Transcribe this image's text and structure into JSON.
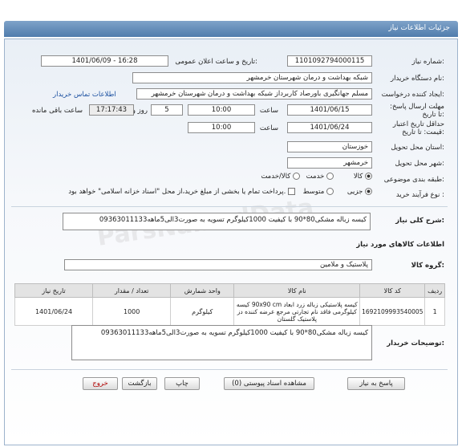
{
  "header": {
    "title": "جزئیات اطلاعات نیاز"
  },
  "fields": {
    "need_number_label": "شماره نیاز:",
    "need_number": "1101092794000115",
    "announce_label": "تاریخ و ساعت اعلان عمومی:",
    "announce_value": "1401/06/09 - 16:28",
    "buyer_label": "نام دستگاه خریدار:",
    "buyer_value": "شبکه بهداشت و درمان شهرستان خرمشهر",
    "creator_label": "ایجاد کننده درخواست:",
    "creator_value": "مسلم جهانگیری باورصاد کاربرداز شبکه بهداشت و درمان شهرستان خرمشهر",
    "contact_link": "اطلاعات تماس خریدار",
    "deadline_label": "مهلت ارسال پاسخ: تا تاریخ:",
    "deadline_date": "1401/06/15",
    "time_label": "ساعت",
    "deadline_time": "10:00",
    "days_value": "5",
    "days_label": "روز و",
    "remaining_time": "17:17:43",
    "remaining_label": "ساعت باقی مانده",
    "validity_label": "حداقل تاریخ اعتبار قیمت: تا تاریخ:",
    "validity_date": "1401/06/24",
    "validity_time_label": "ساعت",
    "validity_time": "10:00",
    "province_label": "استان محل تحویل:",
    "province_value": "خوزستان",
    "city_label": "شهر محل تحویل:",
    "city_value": "خرمشهر",
    "category_label": "طبقه بندی موضوعی:",
    "category_options": [
      "کالا",
      "خدمت",
      "کالا/خدمت"
    ],
    "process_label": "نوع فرآیند خرید :",
    "process_options": [
      "جزیی",
      "متوسط"
    ],
    "payment_text": "پرداخت تمام یا بخشی از مبلغ خرید،از محل \"اسناد خزانه اسلامی\" خواهد بود."
  },
  "summary": {
    "label": "شرح کلی نیاز:",
    "value": "کیسه زباله مشکی80*90 با کیفیت 1000کیلوگرم تسویه به صورت3الی5ماهه09363011133"
  },
  "goods_section": {
    "title": "اطلاعات کالاهای مورد نیاز",
    "group_label": "گروه کالا:",
    "group_value": "پلاستیک و ملامین"
  },
  "table": {
    "headers": [
      "ردیف",
      "کد کالا",
      "نام کالا",
      "واحد شمارش",
      "تعداد / مقدار",
      "تاریخ نیاز"
    ],
    "rows": [
      {
        "row": "1",
        "code": "1692109993540005",
        "name": "کیسه پلاستیکی زباله زرد ابعاد 90x90 cm کیسه کیلوگرمی فاقد نام تجارتی مرجع عرضه کننده دز پلاستیک گلستان",
        "unit": "کیلوگرم",
        "qty": "1000",
        "date": "1401/06/24"
      }
    ]
  },
  "notes": {
    "label": "توضیحات خریدار:",
    "value": "کیسه زباله مشکی80*90 با کیفیت 1000کیلوگرم تسویه به صورت3الی5ماهه09363011133"
  },
  "buttons": {
    "reply": "پاسخ به نیاز",
    "attachments": "مشاهده اسناد پیوستی (0)",
    "print": "چاپ",
    "back": "بازگشت",
    "exit": "خروج"
  }
}
